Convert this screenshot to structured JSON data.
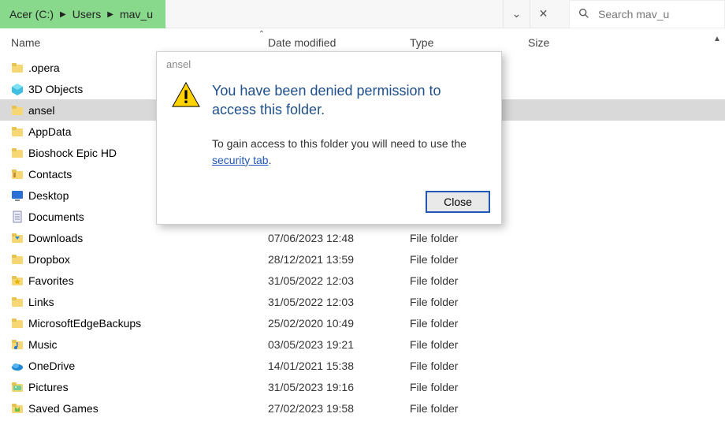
{
  "breadcrumb": {
    "seg0": "Acer (C:)",
    "seg1": "Users",
    "seg2": "mav_u"
  },
  "search": {
    "placeholder": "Search mav_u"
  },
  "columns": {
    "name": "Name",
    "date": "Date modified",
    "type": "Type",
    "size": "Size"
  },
  "dialog": {
    "title": "ansel",
    "headline": "You have been denied permission to access this folder.",
    "message_before": "To gain access to this folder you will need to use the ",
    "link": "security tab",
    "message_after": ".",
    "close": "Close"
  },
  "type_folder": "File folder",
  "rows": [
    {
      "name": ".opera",
      "date": "",
      "type": "",
      "icon": "folder",
      "selected": false
    },
    {
      "name": "3D Objects",
      "date": "",
      "type": "",
      "icon": "f3d",
      "selected": false
    },
    {
      "name": "ansel",
      "date": "",
      "type": "",
      "icon": "folder",
      "selected": true
    },
    {
      "name": "AppData",
      "date": "",
      "type": "",
      "icon": "folder",
      "selected": false
    },
    {
      "name": "Bioshock Epic HD",
      "date": "",
      "type": "",
      "icon": "folder",
      "selected": false
    },
    {
      "name": "Contacts",
      "date": "",
      "type": "",
      "icon": "contacts",
      "selected": false
    },
    {
      "name": "Desktop",
      "date": "",
      "type": "",
      "icon": "desktop",
      "selected": false
    },
    {
      "name": "Documents",
      "date": "",
      "type": "",
      "icon": "documents",
      "selected": false
    },
    {
      "name": "Downloads",
      "date": "07/06/2023 12:48",
      "type": "File folder",
      "icon": "downloads",
      "selected": false
    },
    {
      "name": "Dropbox",
      "date": "28/12/2021 13:59",
      "type": "File folder",
      "icon": "folder",
      "selected": false
    },
    {
      "name": "Favorites",
      "date": "31/05/2022 12:03",
      "type": "File folder",
      "icon": "favorites",
      "selected": false
    },
    {
      "name": "Links",
      "date": "31/05/2022 12:03",
      "type": "File folder",
      "icon": "folder",
      "selected": false
    },
    {
      "name": "MicrosoftEdgeBackups",
      "date": "25/02/2020 10:49",
      "type": "File folder",
      "icon": "folder",
      "selected": false
    },
    {
      "name": "Music",
      "date": "03/05/2023 19:21",
      "type": "File folder",
      "icon": "music",
      "selected": false
    },
    {
      "name": "OneDrive",
      "date": "14/01/2021 15:38",
      "type": "File folder",
      "icon": "onedrive",
      "selected": false
    },
    {
      "name": "Pictures",
      "date": "31/05/2023 19:16",
      "type": "File folder",
      "icon": "pictures",
      "selected": false
    },
    {
      "name": "Saved Games",
      "date": "27/02/2023 19:58",
      "type": "File folder",
      "icon": "saved",
      "selected": false
    }
  ]
}
